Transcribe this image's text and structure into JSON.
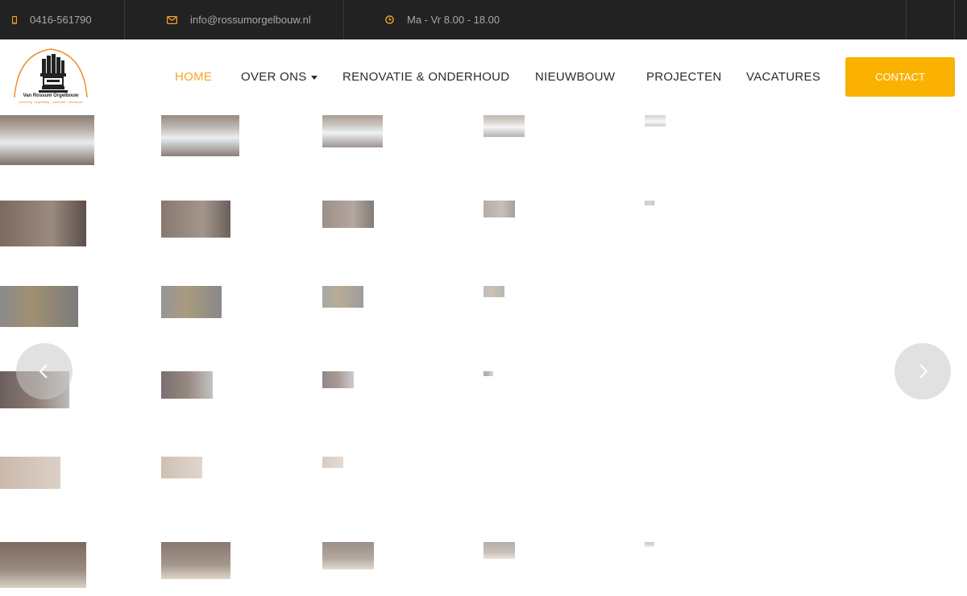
{
  "topbar": {
    "phone": {
      "icon": "mobile-phone-icon",
      "text": "0416-561790"
    },
    "email": {
      "icon": "envelope-icon",
      "text": "info@rossumorgelbouw.nl"
    },
    "hours": {
      "icon": "clock-icon",
      "text": "Ma - Vr 8.00 - 18.00"
    }
  },
  "logo": {
    "name": "Van Rossum Orgelbouw",
    "tagline": "advisering - begeleiding - restauratie - nieuwbouw"
  },
  "nav": {
    "items": [
      {
        "label": "HOME",
        "active": true
      },
      {
        "label": "OVER ONS",
        "dropdown": true
      },
      {
        "label": "RENOVATIE & ONDERHOUD"
      },
      {
        "label": "NIEUWBOUW"
      },
      {
        "label": "PROJECTEN"
      },
      {
        "label": "VACATURES"
      }
    ],
    "contact_label": "CONTACT"
  },
  "slider": {
    "prev_icon": "chevron-left-icon",
    "next_icon": "chevron-right-icon"
  },
  "colors": {
    "accent": "#f5a623",
    "button": "#fbb100",
    "topbar": "#222222"
  }
}
